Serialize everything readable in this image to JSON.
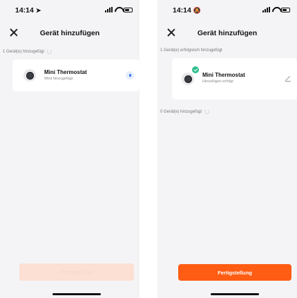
{
  "screens": [
    {
      "status_time": "14:14",
      "status_glyph": "➤",
      "title": "Gerät hinzufügen",
      "section_label": "1 Gerät(e) hinzugefügt",
      "device": {
        "name": "Mini Thermostat",
        "status": "Wird hinzugefügt",
        "icon": "thermostat-icon",
        "action_icon": "progress-icon"
      },
      "button_label": "Fertigstellung",
      "button_state": "disabled"
    },
    {
      "status_time": "14:14",
      "status_glyph": "🔕",
      "title": "Gerät hinzufügen",
      "section_label": "1 Gerät(e) erfolgreich hinzugefügt",
      "device": {
        "name": "Mini Thermostat",
        "status": "Hinzufügen erfolgr.",
        "icon": "thermostat-icon",
        "badge_icon": "check-icon",
        "action_icon": "edit-icon"
      },
      "section_label_2": "0 Gerät(e) hinzugefügt",
      "button_label": "Fertigstellung",
      "button_state": "active"
    }
  ],
  "colors": {
    "accent": "#ff5d14",
    "accent_disabled": "#fbe0d3",
    "success": "#2fbf8f",
    "progress_blue": "#3a7bec",
    "background": "#f4f4f6"
  }
}
